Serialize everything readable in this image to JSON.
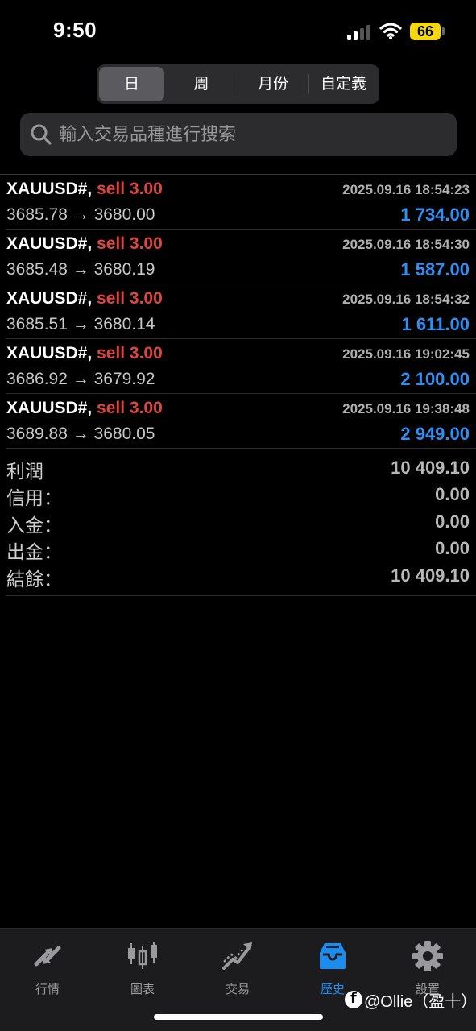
{
  "status_bar": {
    "time": "9:50",
    "battery": "66"
  },
  "period_tabs": [
    {
      "label": "日",
      "active": true
    },
    {
      "label": "周",
      "active": false
    },
    {
      "label": "月份",
      "active": false
    },
    {
      "label": "自定義",
      "active": false
    }
  ],
  "search": {
    "placeholder": "輸入交易品種進行搜索"
  },
  "trades": [
    {
      "symbol": "XAUUSD#,",
      "type": "sell 3.00",
      "prices": "3685.78 → 3680.00",
      "time": "2025.09.16 18:54:23",
      "profit": "1 734.00"
    },
    {
      "symbol": "XAUUSD#,",
      "type": "sell 3.00",
      "prices": "3685.48 → 3680.19",
      "time": "2025.09.16 18:54:30",
      "profit": "1 587.00"
    },
    {
      "symbol": "XAUUSD#,",
      "type": "sell 3.00",
      "prices": "3685.51 → 3680.14",
      "time": "2025.09.16 18:54:32",
      "profit": "1 611.00"
    },
    {
      "symbol": "XAUUSD#,",
      "type": "sell 3.00",
      "prices": "3686.92 → 3679.92",
      "time": "2025.09.16 19:02:45",
      "profit": "2 100.00"
    },
    {
      "symbol": "XAUUSD#,",
      "type": "sell 3.00",
      "prices": "3689.88 → 3680.05",
      "time": "2025.09.16 19:38:48",
      "profit": "2 949.00"
    }
  ],
  "summary": [
    {
      "label": "利潤",
      "value": "10 409.10"
    },
    {
      "label": "信用：",
      "value": "0.00"
    },
    {
      "label": "入金：",
      "value": "0.00"
    },
    {
      "label": "出金：",
      "value": "0.00"
    },
    {
      "label": "結餘：",
      "value": "10 409.10"
    }
  ],
  "tabbar": [
    {
      "label": "行情",
      "icon": "quotes-arrows-icon",
      "active": false
    },
    {
      "label": "圖表",
      "icon": "candlestick-chart-icon",
      "active": false
    },
    {
      "label": "交易",
      "icon": "trade-trend-icon",
      "active": false
    },
    {
      "label": "歷史",
      "icon": "history-tray-icon",
      "active": true
    },
    {
      "label": "設置",
      "icon": "gear-icon",
      "active": false
    }
  ],
  "watermark": {
    "text": "@Ollie（盈十）"
  },
  "colors": {
    "sell": "#e0453c",
    "profit": "#2f8ff2",
    "active_tab": "#1b8df0",
    "battery": "#f5d90a"
  }
}
